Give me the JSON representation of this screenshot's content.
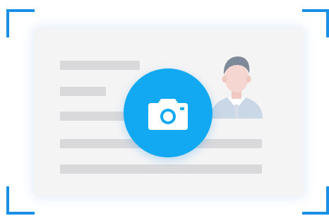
{
  "colors": {
    "accent": "#1ea7f2",
    "corner": "#1a8fe6",
    "card_bg": "#f4f4f5",
    "placeholder_line": "#d9d9db",
    "camera_button": "#12a9f2"
  },
  "icons": {
    "viewfinder": "viewfinder-corners",
    "portrait": "person-portrait",
    "camera": "camera-icon"
  }
}
